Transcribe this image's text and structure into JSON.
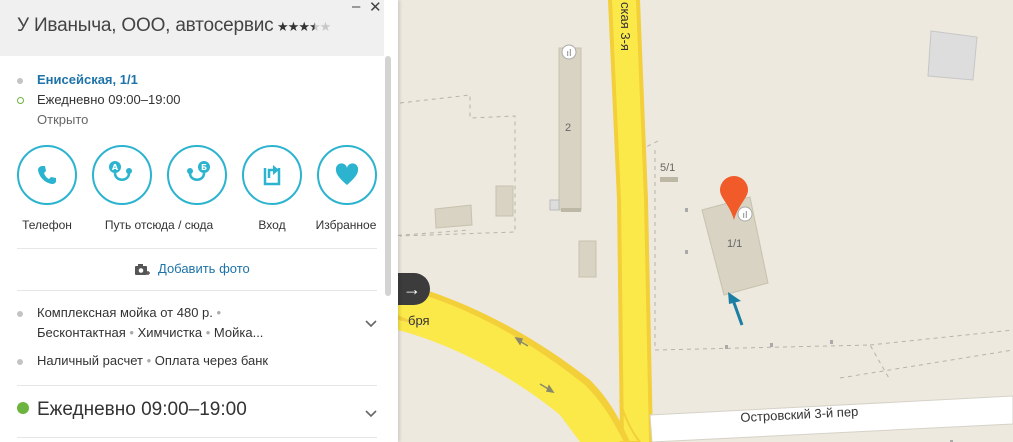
{
  "header": {
    "title": "У Иваныча, ООО, автосервис",
    "rating_stars_filled": 3.5,
    "rating_stars_total": 5,
    "minimize_label": "–",
    "close_label": "✕"
  },
  "info": {
    "address": "Енисейская, 1/1",
    "schedule": "Ежедневно 09:00–19:00",
    "status": "Открыто"
  },
  "actions": [
    {
      "label": "Телефон",
      "icon": "phone-icon"
    },
    {
      "label": "Путь отсюда / сюда",
      "icon": "route-icon"
    },
    {
      "label": "Вход",
      "icon": "entrance-icon"
    },
    {
      "label": "Избранное",
      "icon": "heart-icon"
    }
  ],
  "add_photo": "Добавить фото",
  "services": {
    "line1": "Комплексная мойка от 480 р.",
    "line2a": "Бесконтактная",
    "line2b": "Химчистка",
    "line2c": "Мойка...",
    "payment_a": "Наличный расчет",
    "payment_b": "Оплата через банк"
  },
  "hours_section": "Ежедневно 09:00–19:00",
  "map": {
    "street_vertical": "ская 3-я",
    "street_bottom": "Островский 3-й пер",
    "street_partial": "бря",
    "house_2": "2",
    "house_5_1": "5/1",
    "house_1_1": "1/1",
    "nav_arrow": "→"
  },
  "colors": {
    "accent": "#2bb3cf",
    "link": "#1e73a8",
    "open_green": "#6db33f",
    "road_yellow": "#fbe94a",
    "pin_red": "#f15b2a"
  }
}
